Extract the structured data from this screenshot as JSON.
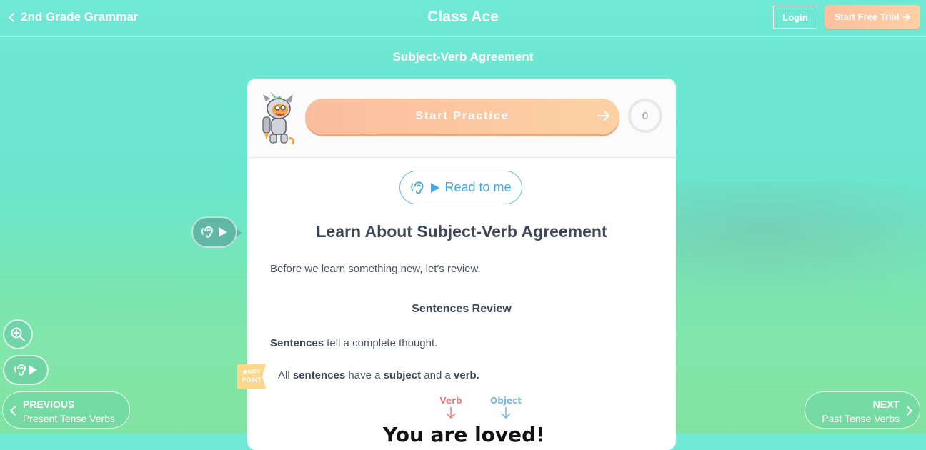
{
  "header": {
    "back_label": "2nd Grade Grammar",
    "brand": "Class Ace",
    "login_label": "Login",
    "trial_label": "Start Free Trial"
  },
  "page_title": "Subject-Verb Agreement",
  "card": {
    "start_practice_label": "Start Practice",
    "score": "0",
    "read_to_me_label": "Read to me",
    "lesson_title": "Learn About Subject-Verb Agreement",
    "intro_text": "Before we learn something new, let's review.",
    "review_heading": "Sentences Review",
    "line1": {
      "bold": "Sentences",
      "rest": " tell a complete thought."
    },
    "line2": {
      "a": "All ",
      "b": "sentences",
      "c": " have a ",
      "d": "subject",
      "e": " and a ",
      "f": "verb."
    },
    "key_point": {
      "line1": "★KEY",
      "line2": "POINT"
    },
    "diagram": {
      "verb_label": "Verb",
      "object_label": "Object",
      "sentence": "You are loved!"
    }
  },
  "nav": {
    "previous_key": "PREVIOUS",
    "previous_title": "Present Tense Verbs",
    "next_key": "NEXT",
    "next_title": "Past Tense Verbs"
  },
  "colors": {
    "accent_peach": "#fbbd9e",
    "link_blue": "#4aa8e0",
    "teal": "#5fb7a4"
  }
}
